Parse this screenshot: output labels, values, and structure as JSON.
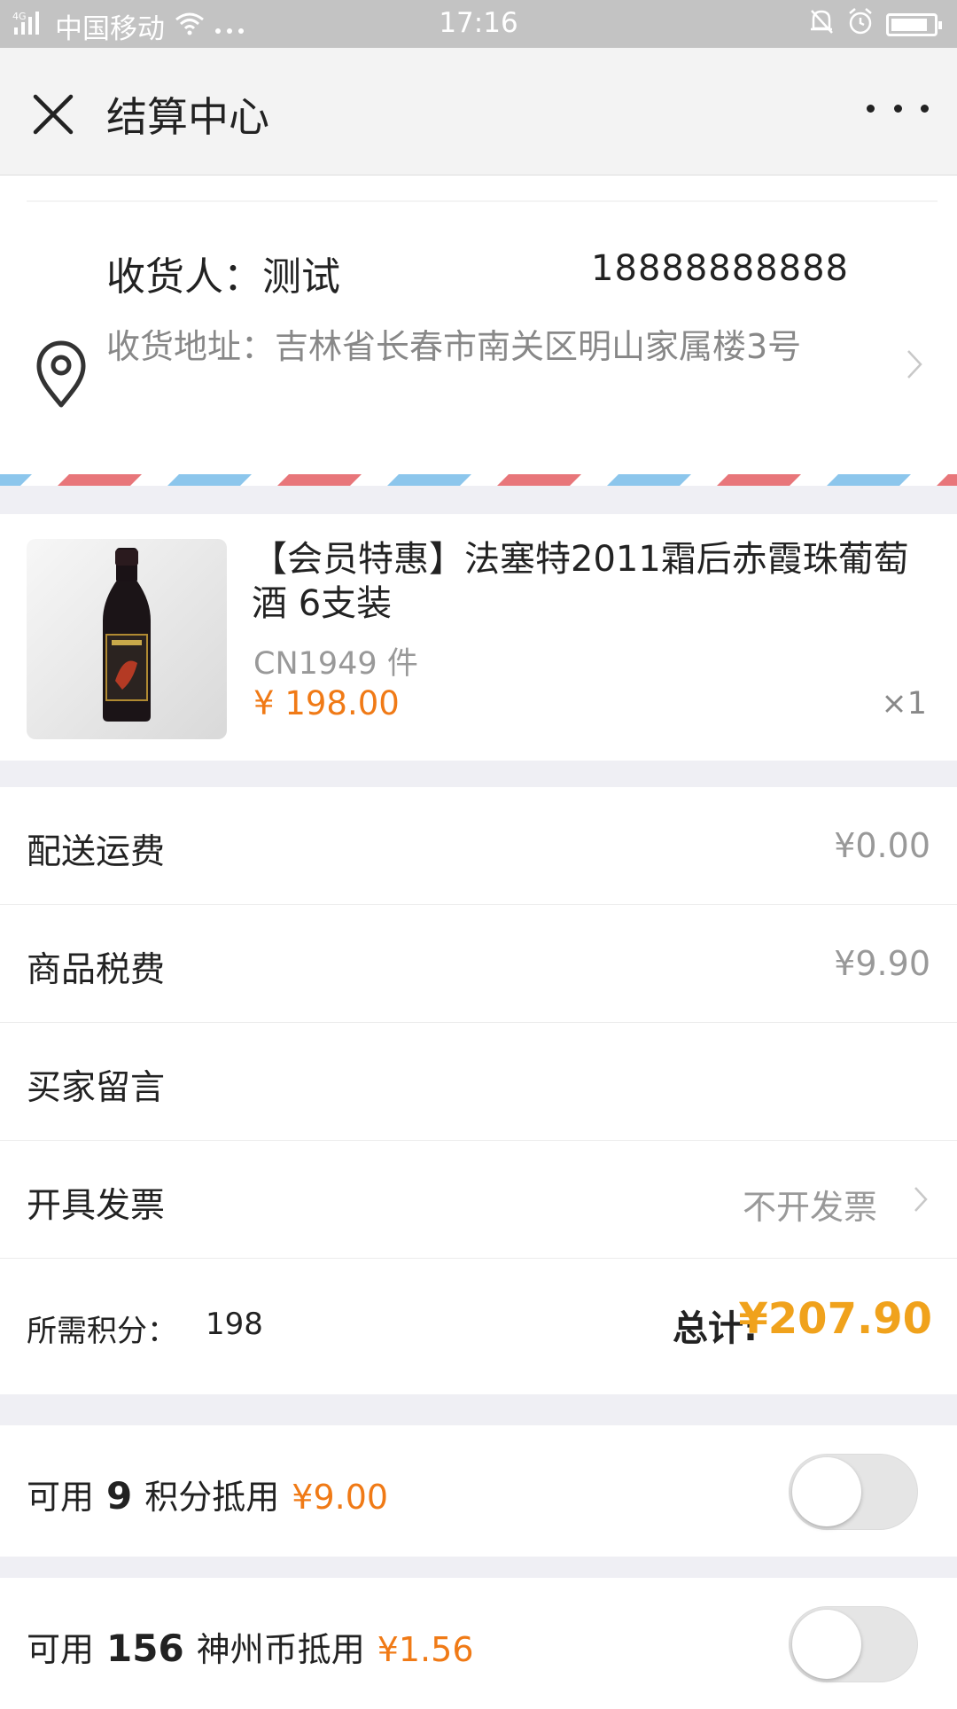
{
  "status_bar": {
    "carrier": "中国移动",
    "network": "4G",
    "time": "17:16"
  },
  "header": {
    "title": "结算中心"
  },
  "address": {
    "receiver": "收货人：测试",
    "phone": "18888888888",
    "address_line": "收货地址：吉林省长春市南关区明山家属楼3号"
  },
  "product": {
    "title": "【会员特惠】法塞特2011霜后赤霞珠葡萄酒 6支装",
    "sku": "CN1949 件",
    "price_symbol": "¥ ",
    "price_main": "198",
    "price_decimal": ".00",
    "quantity": "×1"
  },
  "fees": [
    {
      "label": "配送运费",
      "value": "¥0.00"
    },
    {
      "label": "商品税费",
      "value": "¥9.90"
    },
    {
      "label": "买家留言",
      "value": ""
    },
    {
      "label": "开具发票",
      "value": "不开发票"
    }
  ],
  "summary": {
    "points_label": "所需积分：",
    "points_value": "198",
    "total_label": "总计:",
    "total_value": "¥207.90"
  },
  "offers": [
    {
      "prefix": "可用",
      "count": "9",
      "suffix": "积分抵用",
      "amount": "¥9.00",
      "enabled": false
    },
    {
      "prefix": "可用",
      "count": "156",
      "suffix": "神州币抵用",
      "amount": "¥1.56",
      "enabled": false
    }
  ],
  "colors": {
    "accent_orange": "#f07a16",
    "total_orange": "#f0a21c",
    "airmail_red": "#e8767a",
    "airmail_blue": "#8cc6ec"
  },
  "icons": [
    "signal-icon",
    "wifi-icon",
    "more-dots-icon",
    "alarm-icon",
    "bell-off-icon",
    "battery-icon",
    "close-icon",
    "location-pin-icon",
    "chevron-right-icon"
  ]
}
